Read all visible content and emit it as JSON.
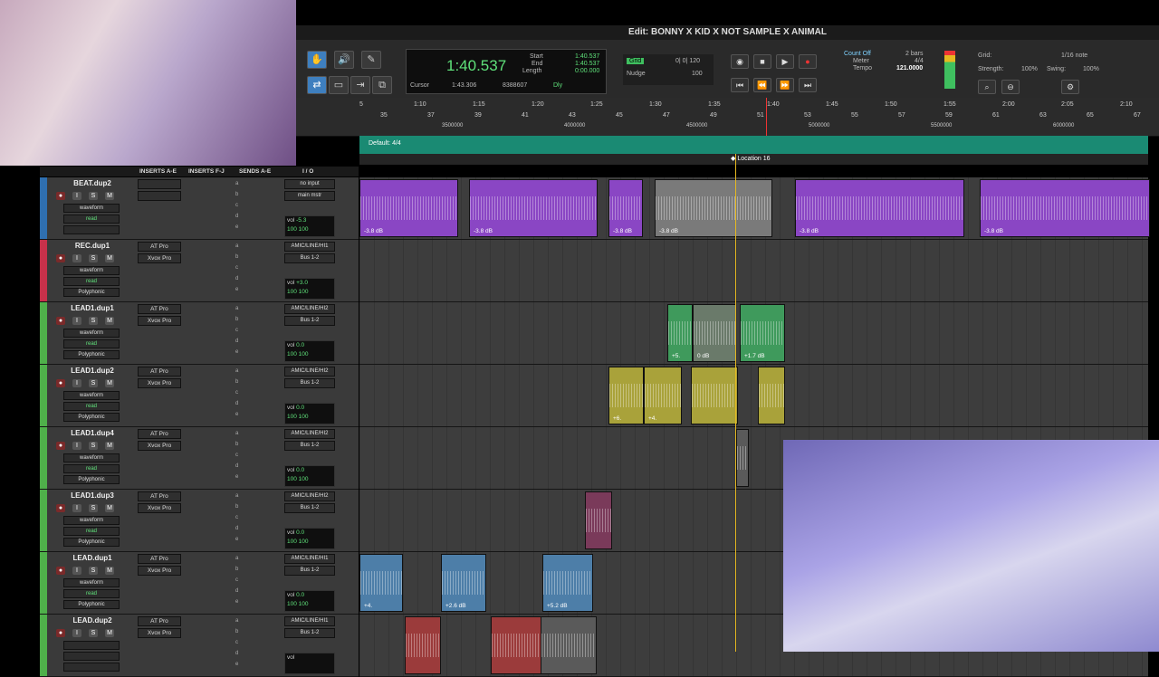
{
  "window": {
    "title": "Edit: BONNY X KID X NOT SAMPLE X ANIMAL"
  },
  "counter": {
    "main": "1:40.537",
    "start_label": "Start",
    "start": "1:40.537",
    "end_label": "End",
    "end": "1:40.537",
    "length_label": "Length",
    "length": "0:00.000",
    "cursor_label": "Cursor",
    "cursor": "1:43.306",
    "cursor_samples": "8388607",
    "dly": "Dly"
  },
  "grid": {
    "label": "Grid",
    "value": "0| 0| 120",
    "nudge_label": "Nudge",
    "nudge_value": "100"
  },
  "count": {
    "count_off": "Count Off",
    "bars": "2 bars",
    "meter_label": "Meter",
    "meter": "4/4",
    "tempo_label": "Tempo",
    "tempo": "121.0000"
  },
  "grid_right": {
    "grid_label": "Grid:",
    "grid_value": "1/16 note",
    "strength_label": "Strength:",
    "strength": "100%",
    "swing_label": "Swing:",
    "swing": "100%"
  },
  "ruler": {
    "times": [
      "5",
      "1:10",
      "1:15",
      "1:20",
      "1:25",
      "1:30",
      "1:35",
      "1:40",
      "1:45",
      "1:50",
      "1:55",
      "2:00",
      "2:05",
      "2:10"
    ],
    "bars": [
      "35",
      "37",
      "39",
      "41",
      "43",
      "45",
      "47",
      "49",
      "51",
      "53",
      "55",
      "57",
      "59",
      "61",
      "63",
      "65",
      "67"
    ],
    "samples": [
      "3500000",
      "4000000",
      "4500000",
      "5000000",
      "5500000",
      "6000000"
    ],
    "meter_default": "Default: 4/4",
    "marker": "Location 16"
  },
  "columns": {
    "inserts_ae": "INSERTS A-E",
    "inserts_fj": "INSERTS F-J",
    "sends_ae": "SENDS A-E",
    "io": "I / O"
  },
  "tracks": [
    {
      "name": "BEAT.dup2",
      "color": "#2f6fb0",
      "ins1": "",
      "ins2": "",
      "in": "no input",
      "out": "main mstr",
      "view": "waveform",
      "auto": "read",
      "dyn": "dyn",
      "mode": "",
      "vol": "-5.3",
      "pan": "100  100",
      "gain": "-3.8 dB"
    },
    {
      "name": "REC.dup1",
      "color": "#c7314a",
      "ins1": "AT Pro",
      "ins2": "Xvox Pro",
      "in": "AMIC/LINE/HI1",
      "out": "Bus 1-2",
      "view": "waveform",
      "auto": "read",
      "dyn": "dyn",
      "mode": "Polyphonic",
      "vol": "+3.0",
      "pan": "100  100",
      "gain": ""
    },
    {
      "name": "LEAD1.dup1",
      "color": "#4fb04a",
      "ins1": "AT Pro",
      "ins2": "Xvox Pro",
      "in": "AMIC/LINE/HI2",
      "out": "Bus 1-2",
      "view": "waveform",
      "auto": "read",
      "dyn": "dyn",
      "mode": "Polyphonic",
      "vol": "0.0",
      "pan": "100  100",
      "gain": "0 dB"
    },
    {
      "name": "LEAD1.dup2",
      "color": "#4fb04a",
      "ins1": "AT Pro",
      "ins2": "Xvox Pro",
      "in": "AMIC/LINE/HI2",
      "out": "Bus 1-2",
      "view": "waveform",
      "auto": "read",
      "dyn": "dyn",
      "mode": "Polyphonic",
      "vol": "0.0",
      "pan": "100  100",
      "gain": "+6."
    },
    {
      "name": "LEAD1.dup4",
      "color": "#4fb04a",
      "ins1": "AT Pro",
      "ins2": "Xvox Pro",
      "in": "AMIC/LINE/HI2",
      "out": "Bus 1-2",
      "view": "waveform",
      "auto": "read",
      "dyn": "dyn",
      "mode": "Polyphonic",
      "vol": "0.0",
      "pan": "100  100",
      "gain": ""
    },
    {
      "name": "LEAD1.dup3",
      "color": "#4fb04a",
      "ins1": "AT Pro",
      "ins2": "Xvox Pro",
      "in": "AMIC/LINE/HI2",
      "out": "Bus 1-2",
      "view": "waveform",
      "auto": "read",
      "dyn": "dyn",
      "mode": "Polyphonic",
      "vol": "0.0",
      "pan": "100  100",
      "gain": ""
    },
    {
      "name": "LEAD.dup1",
      "color": "#4fb04a",
      "ins1": "AT Pro",
      "ins2": "Xvox Pro",
      "in": "AMIC/LINE/HI1",
      "out": "Bus 1-2",
      "view": "waveform",
      "auto": "read",
      "dyn": "dyn",
      "mode": "Polyphonic",
      "vol": "0.0",
      "pan": "100  100",
      "gain": "+2.6 dB"
    },
    {
      "name": "LEAD.dup2",
      "color": "#4fb04a",
      "ins1": "AT Pro",
      "ins2": "Xvox Pro",
      "in": "AMIC/LINE/HI1",
      "out": "Bus 1-2",
      "view": "",
      "auto": "",
      "dyn": "",
      "mode": "",
      "vol": "",
      "pan": "",
      "gain": ""
    }
  ],
  "clip_gains": {
    "beat": [
      "-3.8 dB",
      "-3.8 dB",
      "-3.8 dB",
      "-3.8 dB",
      "-3.8 dB",
      "-3.8 dB"
    ],
    "lead1dup1": [
      "+5.",
      "0 dB",
      "+1.7 dB"
    ],
    "lead1dup2": [
      "+6.",
      "+4."
    ],
    "leaddup1": [
      "+4.",
      "+2.6 dB",
      "+5.2 dB"
    ]
  },
  "colors": {
    "beat_clip": "#8a46c4",
    "lead1_clip": "#3f9a5c",
    "lead1dup2_clip": "#a9a23a",
    "lead_clip": "#4d7ea8",
    "leaddup2_clip": "#9b3b3b",
    "meter_ruler": "#1a8a73",
    "playhead": "#e6b820"
  }
}
